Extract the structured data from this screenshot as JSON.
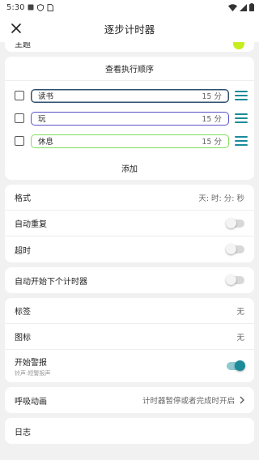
{
  "status": {
    "time": "5:30"
  },
  "title": "逐步计时器",
  "theme": {
    "label": "主题",
    "color": "#c6ee1c"
  },
  "steps_card": {
    "view_order": "查看执行顺序",
    "add": "添加",
    "steps": [
      {
        "name": "读书",
        "duration": "15 分",
        "color": "#2f4f6f"
      },
      {
        "name": "玩",
        "duration": "15 分",
        "color": "#5b53c9"
      },
      {
        "name": "休息",
        "duration": "15 分",
        "color": "#7ee05a"
      }
    ]
  },
  "format_card": {
    "format_label": "格式",
    "format_value": "天: 时: 分: 秒",
    "auto_repeat": "自动重复",
    "overtime": "超时"
  },
  "auto_next": {
    "label": "自动开始下个计时器"
  },
  "alert_card": {
    "tag_label": "标签",
    "tag_value": "无",
    "icon_label": "图标",
    "icon_value": "无",
    "alarm_label": "开始警报",
    "alarm_sub": "铃声:短警报声"
  },
  "breath": {
    "label": "呼吸动画",
    "value": "计时器暂停或者完成时开启"
  },
  "log": {
    "label": "日志"
  },
  "colors": {
    "accent": "#1b8b99",
    "background": "#f1f1f1"
  }
}
